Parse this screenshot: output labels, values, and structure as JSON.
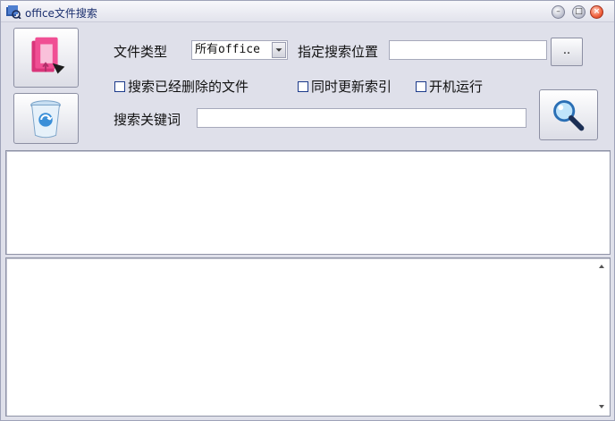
{
  "window": {
    "title": "office文件搜索",
    "minimize_icon": "minimize-icon",
    "maximize_icon": "maximize-icon",
    "close_icon": "close-icon"
  },
  "toolbar": {
    "open_button_icon": "folder-document-icon",
    "recycle_button_icon": "recycle-bin-icon",
    "search_button_icon": "magnifier-icon",
    "browse_label": ".."
  },
  "form": {
    "file_type_label": "文件类型",
    "file_type_value": "所有office",
    "location_label": "指定搜索位置",
    "location_value": "",
    "keyword_label": "搜索关键词",
    "keyword_value": ""
  },
  "options": [
    {
      "label": "搜索已经删除的文件",
      "checked": false
    },
    {
      "label": "同时更新索引",
      "checked": false
    },
    {
      "label": "开机运行",
      "checked": false
    }
  ],
  "colors": {
    "title_text": "#1b2f6e",
    "window_bg": "#dfe0ea",
    "close_button": "#f0603c"
  }
}
